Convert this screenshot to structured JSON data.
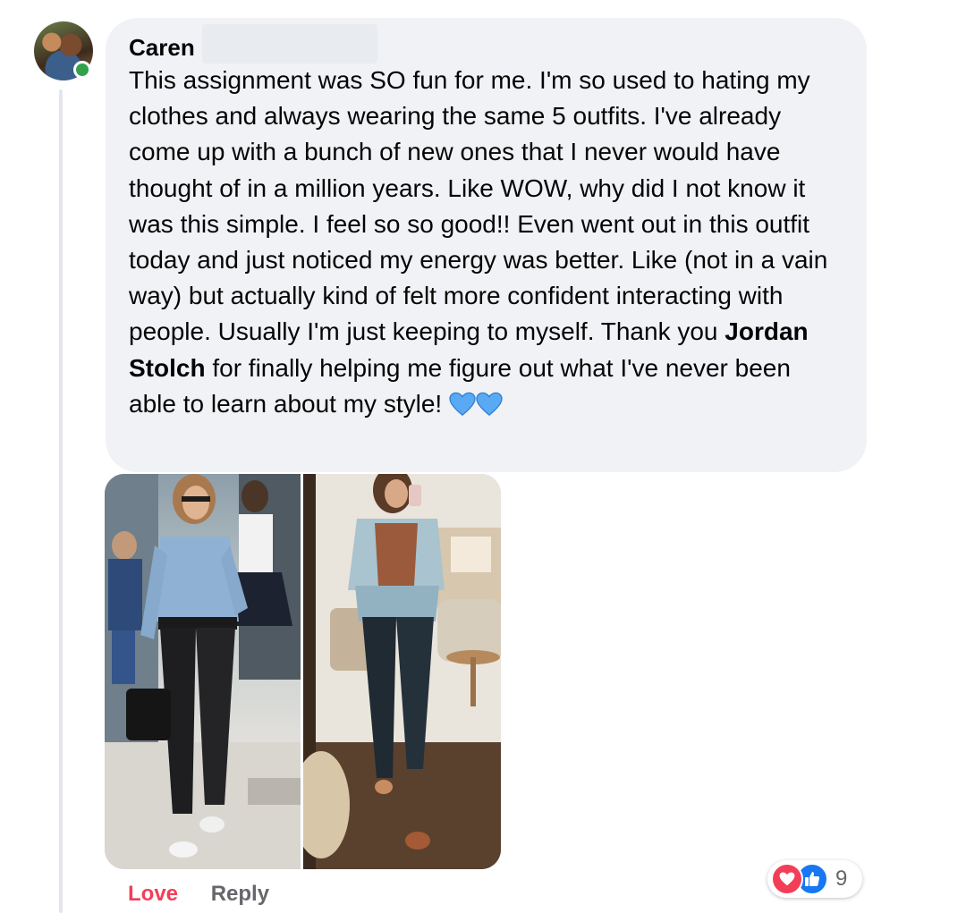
{
  "comment": {
    "author": "Caren",
    "text_before": "This assignment was SO fun for me. I'm so used to hating my clothes and always wearing the same 5 outfits. I've already come up with a bunch of new ones that I never would have thought of in a million years. Like WOW, why did I not know it was this simple. I feel so so good!! Even went out in this outfit today and just noticed my energy was better. Like (not in a vain way) but actually kind of felt more confident interacting with people. Usually I'm just keeping to myself. Thank you ",
    "mention": "Jordan Stolch",
    "text_after": " for finally helping me figure out what I've never been able to learn about my style!",
    "emoji": [
      "blue-heart",
      "blue-heart"
    ],
    "author_online": true
  },
  "actions": {
    "love_label": "Love",
    "reply_label": "Reply"
  },
  "reactions": {
    "types": [
      "love-icon",
      "like-icon"
    ],
    "count": "9"
  },
  "colors": {
    "bubble": "#f0f2f5",
    "love": "#f33e58",
    "like": "#1877f2",
    "muted": "#65676b",
    "online": "#31a24c",
    "blue_heart": "#5aa9f5"
  }
}
